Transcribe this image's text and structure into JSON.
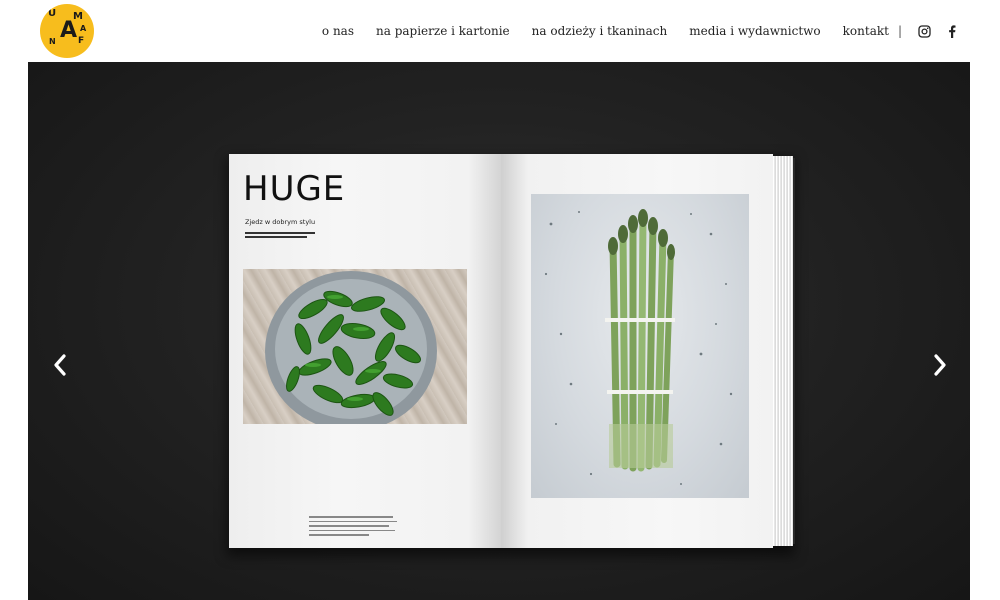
{
  "brand": {
    "letters": [
      "U",
      "M",
      "A",
      "A",
      "F",
      "N"
    ],
    "accent_color": "#f7bd1d"
  },
  "nav": {
    "items": [
      "o nas",
      "na papierze i kartonie",
      "na odzieży i tkaninach",
      "media i wydawnictwo",
      "kontakt"
    ],
    "separator": "|",
    "icons": [
      "instagram-icon",
      "facebook-icon"
    ]
  },
  "slider": {
    "prev_icon": "chevron-left-icon",
    "next_icon": "chevron-right-icon"
  },
  "magazine": {
    "title": "HUGE",
    "subtitle": "Zjedz w dobrym stylu"
  }
}
